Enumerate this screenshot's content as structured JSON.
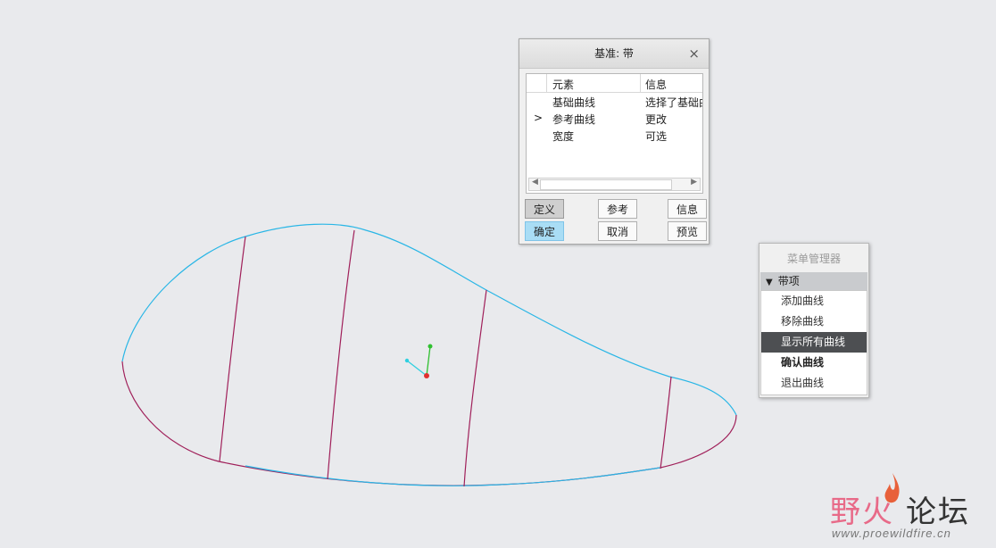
{
  "dialog": {
    "title": "基准: 带",
    "close": "×",
    "columns": [
      "元素",
      "信息"
    ],
    "rows": [
      {
        "marker": "",
        "element": "基础曲线",
        "info": "选择了基础曲"
      },
      {
        "marker": ">",
        "element": "参考曲线",
        "info": "更改"
      },
      {
        "marker": "",
        "element": "宽度",
        "info": "可选"
      }
    ],
    "buttons": {
      "define": "定义",
      "ref": "参考",
      "info": "信息",
      "ok": "确定",
      "cancel": "取消",
      "preview": "预览"
    }
  },
  "menu_manager": {
    "title": "菜单管理器",
    "section": "带项",
    "items": [
      "添加曲线",
      "移除曲线",
      "显示所有曲线",
      "确认曲线",
      "退出曲线"
    ],
    "selected": "显示所有曲线"
  },
  "watermark": {
    "brand_cn_1": "野火",
    "brand_cn_2": "论坛",
    "url": "www.proewildfire.cn"
  },
  "colors": {
    "background": "#e9eaed",
    "curve_cyan": "#29b6e6",
    "curve_magenta": "#a0205a",
    "axis_red": "#e03030",
    "axis_green": "#30c030",
    "axis_cyan": "#30d0e0",
    "menu_selected": "#4d4f52",
    "ok_button": "#a9ddf5"
  }
}
